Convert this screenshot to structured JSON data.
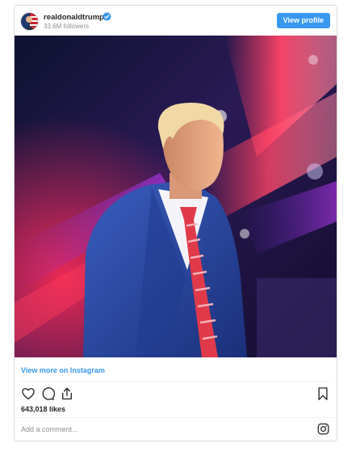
{
  "header": {
    "username": "realdonaldtrump",
    "followers": "33.6M followers",
    "view_profile_label": "View profile"
  },
  "icons": {
    "avatar": "avatar-image",
    "verified": "verified-badge-icon",
    "like": "heart-icon",
    "comment": "comment-icon",
    "share": "share-icon",
    "save": "bookmark-icon",
    "instagram": "instagram-logo-icon"
  },
  "post": {
    "view_more_label": "View more on Instagram",
    "likes": "643,018 likes"
  },
  "comment": {
    "placeholder": "Add a comment..."
  },
  "colors": {
    "accent": "#3897f0",
    "border": "#dbdbdb",
    "muted": "#8e8e8e"
  }
}
